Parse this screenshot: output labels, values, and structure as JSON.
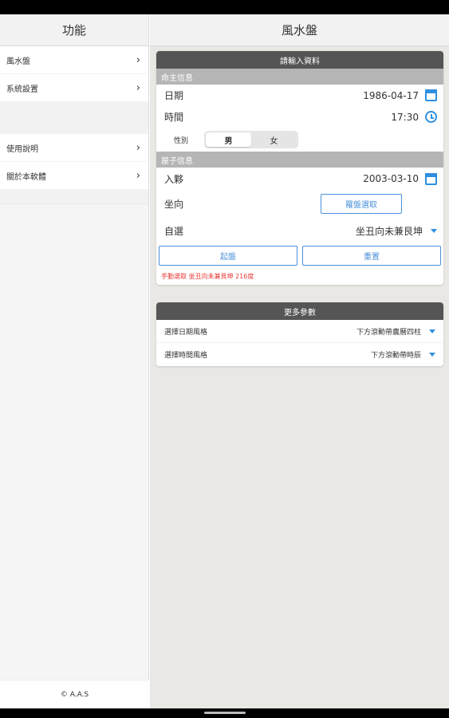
{
  "sidebar": {
    "title": "功能",
    "items": [
      {
        "label": "風水盤"
      },
      {
        "label": "系統設置"
      },
      {
        "label": "使用說明"
      },
      {
        "label": "關於本軟體"
      }
    ],
    "footer": "© A.A.S"
  },
  "main": {
    "title": "風水盤",
    "input_card": {
      "title": "請輸入資料",
      "owner_section": "命主信息",
      "date_label": "日期",
      "date_value": "1986-04-17",
      "time_label": "時間",
      "time_value": "17:30",
      "gender_label": "性別",
      "gender_options": [
        "男",
        "女"
      ],
      "gender_selected": "男",
      "house_section": "屋子信息",
      "movein_label": "入夥",
      "movein_value": "2003-03-10",
      "facing_label": "坐向",
      "compass_button": "羅盤選取",
      "select_label": "自選",
      "select_value": "坐丑向未兼艮坤",
      "start_button": "起盤",
      "reset_button": "重置",
      "notice": "手動選取 坐丑向未兼艮坤 216度"
    },
    "more_card": {
      "title": "更多參數",
      "params": [
        {
          "label": "選擇日期風格",
          "value": "下方滾動帶農曆四柱"
        },
        {
          "label": "選擇時間風格",
          "value": "下方滾動帶時辰"
        }
      ]
    }
  },
  "colors": {
    "accent": "#2f8fe0",
    "card_header": "#555555",
    "section_header": "#b5b5b5",
    "notice": "#e53935",
    "background": "#e9e8e4"
  },
  "icons": {
    "date": "calendar-icon",
    "time": "clock-icon",
    "menu_chevron": "chevron-right-icon",
    "dropdown": "caret-down-icon"
  }
}
